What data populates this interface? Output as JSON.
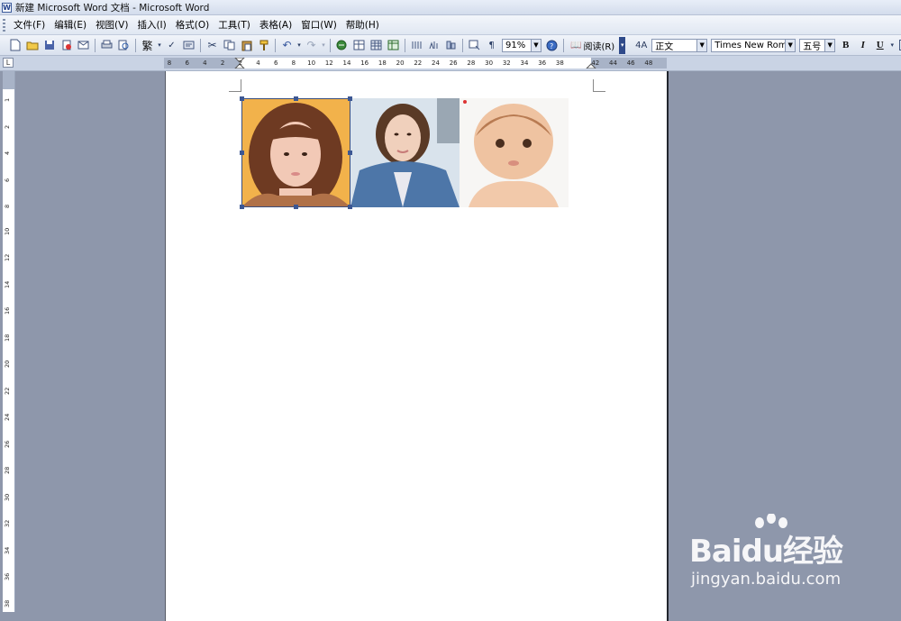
{
  "window": {
    "title": "新建 Microsoft Word 文档 - Microsoft Word",
    "app_icon": "word-doc-icon"
  },
  "menu": {
    "items": [
      "文件(F)",
      "编辑(E)",
      "视图(V)",
      "插入(I)",
      "格式(O)",
      "工具(T)",
      "表格(A)",
      "窗口(W)",
      "帮助(H)"
    ]
  },
  "toolbar": {
    "zoom": "91%",
    "read_label": "阅读(R)",
    "style": "正文",
    "font": "Times New Roman",
    "size": "五号",
    "bold_label": "B",
    "italic_label": "I",
    "underline_label": "U",
    "traditional_label": "繁"
  },
  "ruler": {
    "corner": "L",
    "h_ticks": [
      "8",
      "6",
      "4",
      "2",
      "2",
      "4",
      "6",
      "8",
      "10",
      "12",
      "14",
      "16",
      "18",
      "20",
      "22",
      "24",
      "26",
      "28",
      "30",
      "32",
      "34",
      "36",
      "38",
      "42",
      "44",
      "46",
      "48"
    ],
    "v_ticks": [
      "1",
      "2",
      "4",
      "6",
      "8",
      "10",
      "12",
      "14",
      "16",
      "18",
      "20",
      "22",
      "24",
      "26",
      "28",
      "30",
      "32",
      "34",
      "36",
      "38"
    ]
  },
  "document": {
    "images": [
      {
        "name": "photo-girl-bangs",
        "caption": "woman with bangs"
      },
      {
        "name": "photo-girl-denim",
        "caption": "woman in denim jacket"
      },
      {
        "name": "photo-baby",
        "caption": "baby"
      }
    ]
  },
  "watermark": {
    "brand": "Baidu经验",
    "url": "jingyan.baidu.com"
  },
  "colors": {
    "workspace": "#8e97ab",
    "page": "#ffffff",
    "selection": "#3c5793"
  }
}
